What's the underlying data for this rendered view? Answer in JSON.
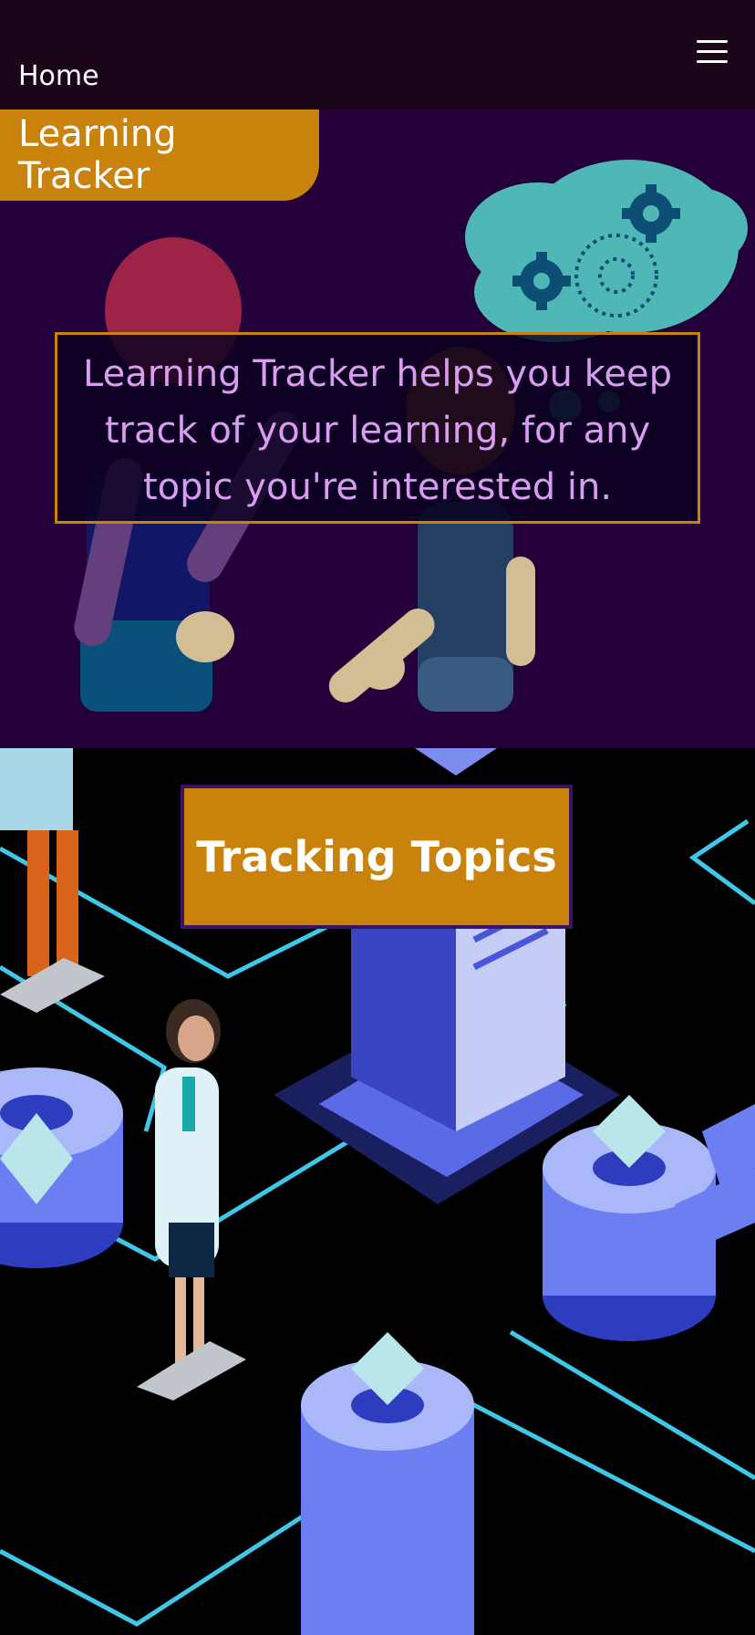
{
  "nav": {
    "home_label": "Home",
    "menu_icon": "hamburger-menu-icon"
  },
  "hero": {
    "tab_label": "Learning Tracker",
    "description": "Learning Tracker helps you keep track of your learning, for any topic you're interested in."
  },
  "topics": {
    "banner_label": "Tracking Topics"
  },
  "colors": {
    "accent": "#c9830c",
    "nav_bg": "#1a0519",
    "hero_bg": "#24003a",
    "hero_text": "#d99df0",
    "banner_border": "#3b1468"
  }
}
